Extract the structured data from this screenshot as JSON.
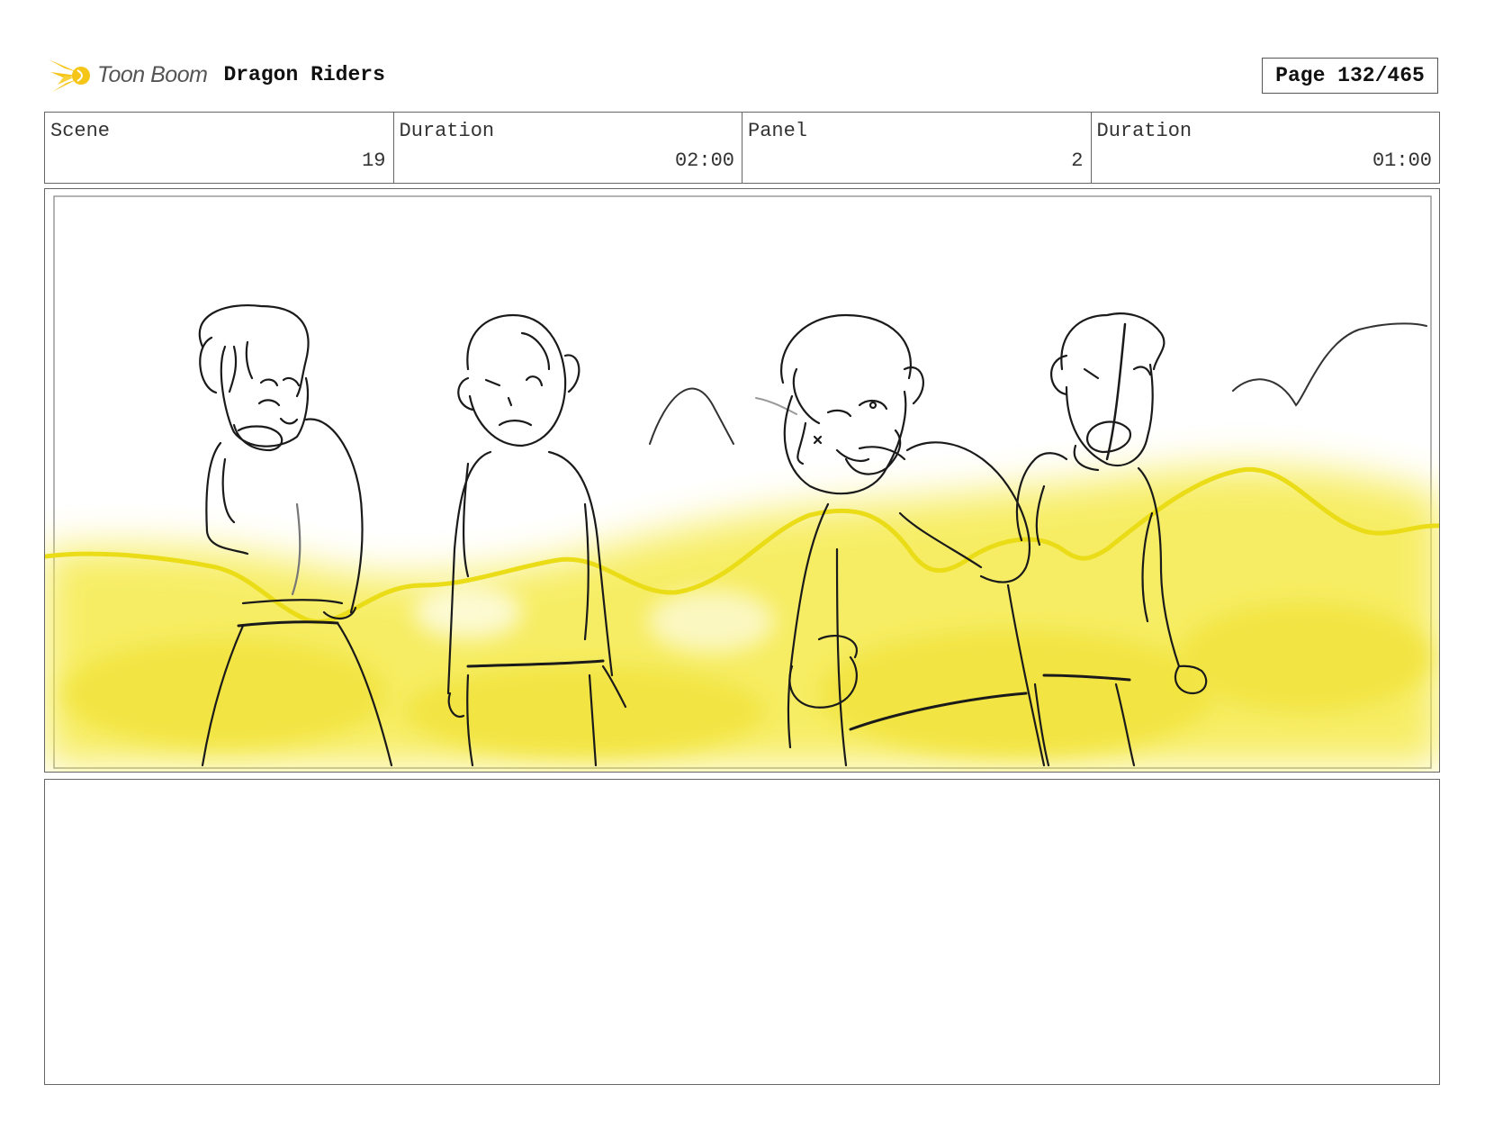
{
  "header": {
    "logo_text": "Toon Boom",
    "project_title": "Dragon Riders",
    "page_label": "Page 132/465"
  },
  "info": {
    "scene_label": "Scene",
    "scene_value": "19",
    "scene_duration_label": "Duration",
    "scene_duration_value": "02:00",
    "panel_label": "Panel",
    "panel_value": "2",
    "panel_duration_label": "Duration",
    "panel_duration_value": "01:00"
  },
  "colors": {
    "logo_yellow": "#f5c518",
    "highlight_yellow": "#f2e52a",
    "line_yellow": "#eadc17",
    "sketch": "#1a1a1a",
    "border": "#666666"
  },
  "icons": {
    "logo": "toon-boom-star-icon"
  },
  "notes": {}
}
